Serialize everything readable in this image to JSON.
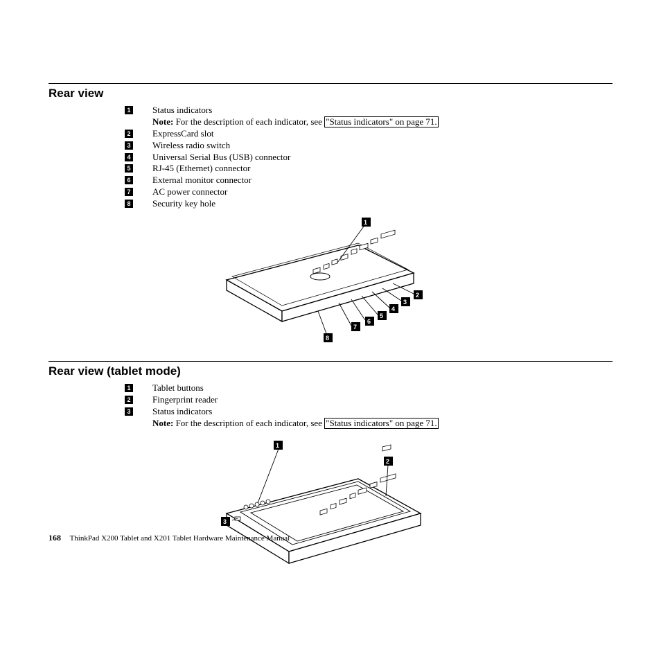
{
  "section1": {
    "heading": "Rear view",
    "items": [
      {
        "num": "1",
        "text": "Status indicators",
        "hasNote": true
      },
      {
        "num": "2",
        "text": "ExpressCard slot"
      },
      {
        "num": "3",
        "text": "Wireless radio switch"
      },
      {
        "num": "4",
        "text": "Universal Serial Bus (USB) connector"
      },
      {
        "num": "5",
        "text": "RJ-45 (Ethernet) connector"
      },
      {
        "num": "6",
        "text": "External monitor connector"
      },
      {
        "num": "7",
        "text": "AC power connector"
      },
      {
        "num": "8",
        "text": "Security key hole"
      }
    ],
    "note_prefix": "Note:",
    "note_text": " For the description of each indicator, see ",
    "xref": "\"Status indicators\" on page 71."
  },
  "section2": {
    "heading": "Rear view (tablet mode)",
    "items": [
      {
        "num": "1",
        "text": "Tablet buttons"
      },
      {
        "num": "2",
        "text": "Fingerprint reader"
      },
      {
        "num": "3",
        "text": "Status indicators",
        "hasNote": true
      }
    ],
    "note_prefix": "Note:",
    "note_text": " For the description of each indicator, see ",
    "xref": "\"Status indicators\" on page 71."
  },
  "footer": {
    "page": "168",
    "book": "ThinkPad X200 Tablet and X201 Tablet Hardware Maintenance Manual"
  },
  "callouts1": [
    "1",
    "2",
    "3",
    "4",
    "5",
    "6",
    "7",
    "8"
  ],
  "callouts2": [
    "1",
    "2",
    "3"
  ]
}
